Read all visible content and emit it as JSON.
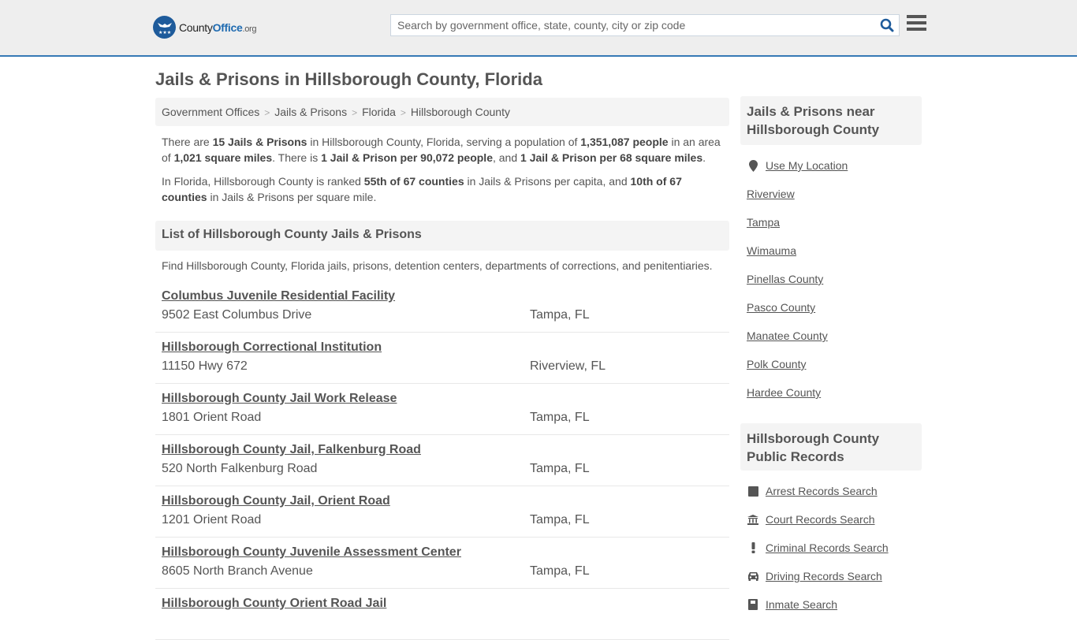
{
  "header": {
    "logo": {
      "county": "County",
      "office": "Office",
      "org": ".org"
    },
    "search": {
      "placeholder": "Search by government office, state, county, city or zip code",
      "value": ""
    },
    "accent_color": "#3679b5"
  },
  "page": {
    "title": "Jails & Prisons in Hillsborough County, Florida",
    "breadcrumb": [
      "Government Offices",
      "Jails & Prisons",
      "Florida",
      "Hillsborough County"
    ],
    "intro": {
      "p1": {
        "t1": "There are ",
        "b1": "15 Jails & Prisons",
        "t2": " in Hillsborough County, Florida, serving a population of ",
        "b2": "1,351,087 people",
        "t3": " in an area of ",
        "b3": "1,021 square miles",
        "t4": ". There is ",
        "b4": "1 Jail & Prison per 90,072 people",
        "t5": ", and ",
        "b5": "1 Jail & Prison per 68 square miles",
        "t6": "."
      },
      "p2": {
        "t1": "In Florida, Hillsborough County is ranked ",
        "b1": "55th of 67 counties",
        "t2": " in Jails & Prisons per capita, and ",
        "b2": "10th of 67 counties",
        "t3": " in Jails & Prisons per square mile."
      }
    },
    "list_header": "List of Hillsborough County Jails & Prisons",
    "list_desc": "Find Hillsborough County, Florida jails, prisons, detention centers, departments of corrections, and penitentiaries.",
    "facilities": [
      {
        "name": "Columbus Juvenile Residential Facility",
        "address": "9502 East Columbus Drive",
        "city": "Tampa, FL"
      },
      {
        "name": "Hillsborough Correctional Institution",
        "address": "11150 Hwy 672",
        "city": "Riverview, FL"
      },
      {
        "name": "Hillsborough County Jail Work Release",
        "address": "1801 Orient Road",
        "city": "Tampa, FL"
      },
      {
        "name": "Hillsborough County Jail, Falkenburg Road",
        "address": "520 North Falkenburg Road",
        "city": "Tampa, FL"
      },
      {
        "name": "Hillsborough County Jail, Orient Road",
        "address": "1201 Orient Road",
        "city": "Tampa, FL"
      },
      {
        "name": "Hillsborough County Juvenile Assessment Center",
        "address": "8605 North Branch Avenue",
        "city": "Tampa, FL"
      },
      {
        "name": "Hillsborough County Orient Road Jail",
        "address": "",
        "city": ""
      }
    ]
  },
  "sidebar": {
    "near_title": "Jails & Prisons near Hillsborough County",
    "use_location": "Use My Location",
    "near_links": [
      "Riverview",
      "Tampa",
      "Wimauma",
      "Pinellas County",
      "Pasco County",
      "Manatee County",
      "Polk County",
      "Hardee County"
    ],
    "records_title": "Hillsborough County Public Records",
    "records_links": [
      {
        "label": "Arrest Records Search",
        "icon": "square-icon"
      },
      {
        "label": "Court Records Search",
        "icon": "courthouse-icon"
      },
      {
        "label": "Criminal Records Search",
        "icon": "exclamation-icon"
      },
      {
        "label": "Driving Records Search",
        "icon": "car-icon"
      },
      {
        "label": "Inmate Search",
        "icon": "inmate-icon"
      }
    ]
  }
}
